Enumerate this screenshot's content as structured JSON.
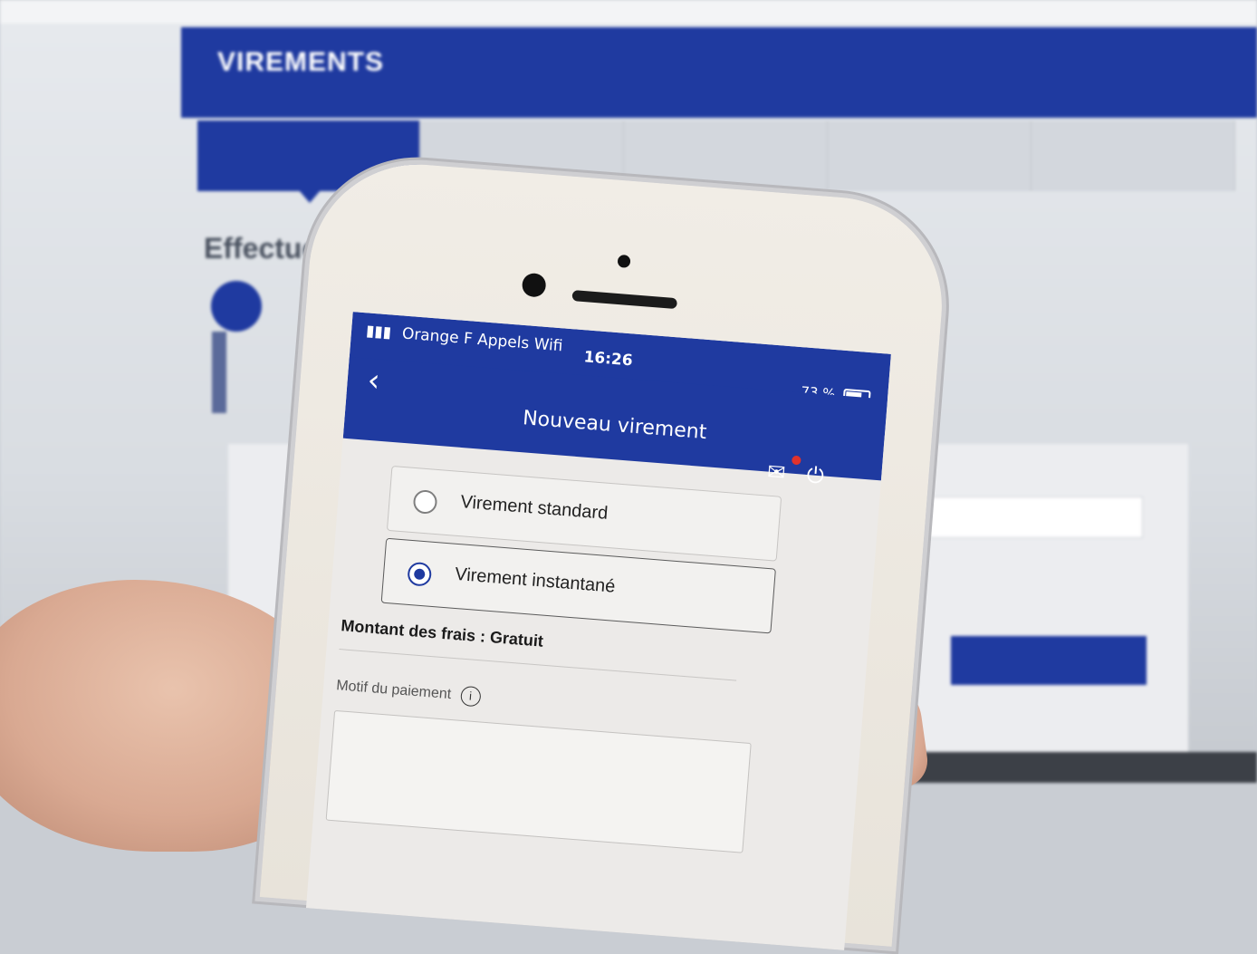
{
  "monitor": {
    "header_title": "VIREMENTS",
    "heading": "Effectuer u"
  },
  "phone": {
    "status": {
      "carrier": "Orange F Appels Wifi",
      "time": "16:26",
      "battery": "73 %"
    },
    "nav": {
      "back_icon": "‹",
      "title": "Nouveau virement"
    },
    "options": [
      {
        "label": "Virement standard",
        "selected": false
      },
      {
        "label": "Virement instantané",
        "selected": true
      }
    ],
    "fees": "Montant des frais : Gratuit",
    "motif_label": "Motif du paiement",
    "info_icon": "i"
  },
  "colors": {
    "brand_blue": "#1f3aa0",
    "notification_red": "#e0322c"
  }
}
